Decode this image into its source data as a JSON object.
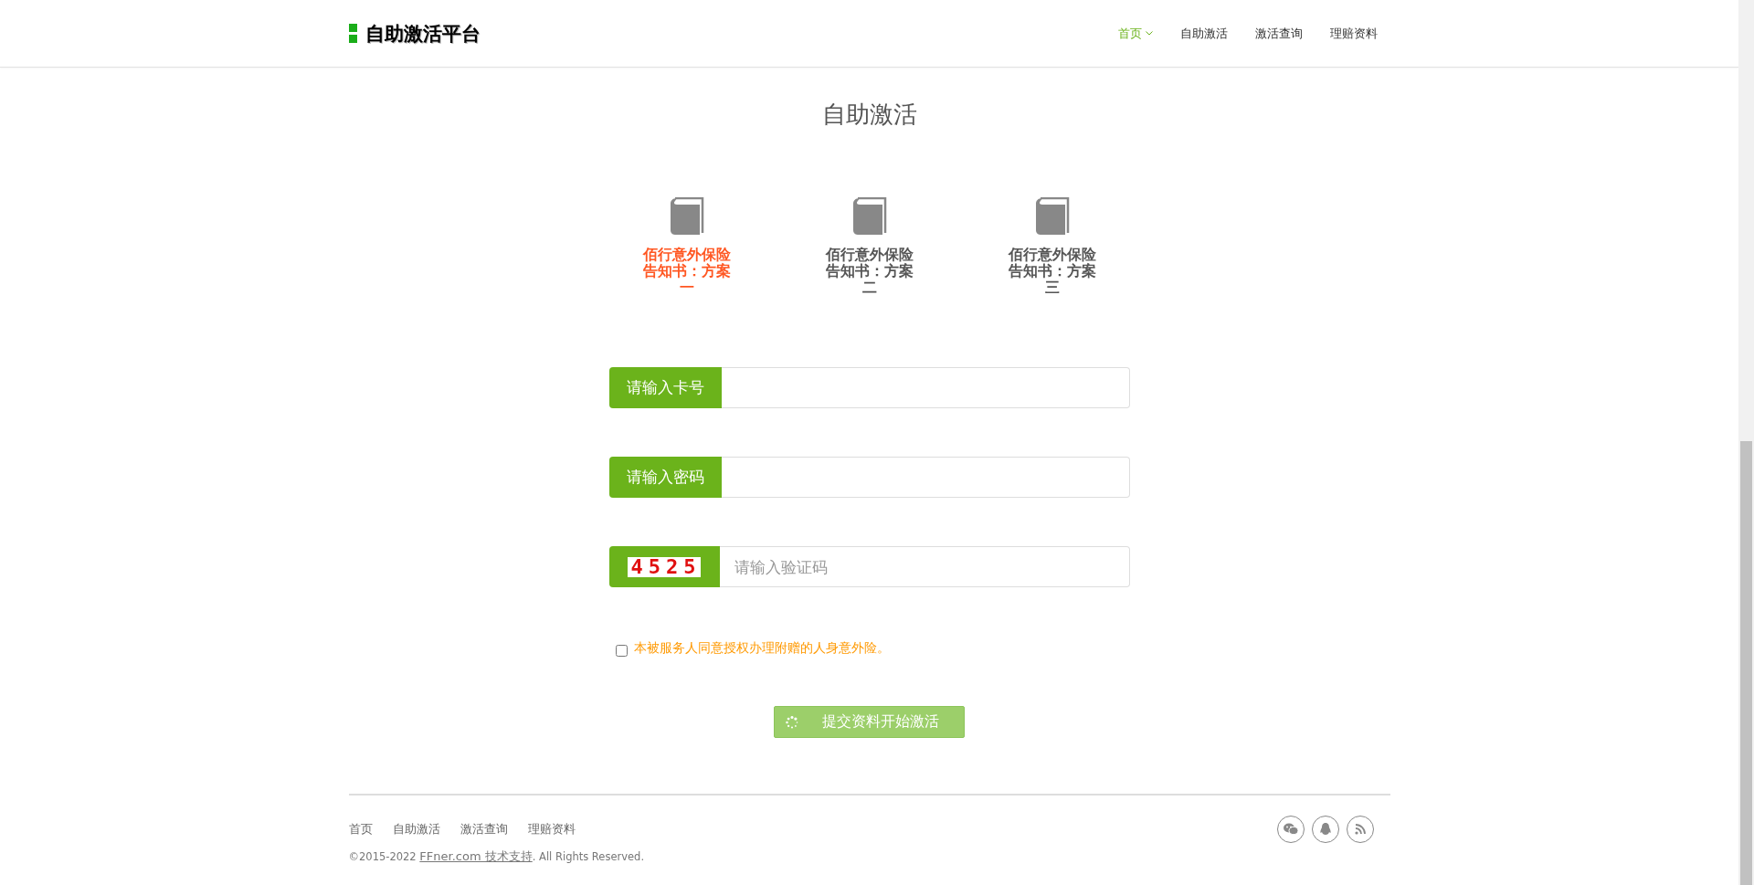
{
  "header": {
    "logo_text": "自助激活平台",
    "nav": [
      {
        "label": "首页",
        "selected": true,
        "dropdown": true
      },
      {
        "label": "自助激活",
        "selected": false,
        "dropdown": false
      },
      {
        "label": "激活查询",
        "selected": false,
        "dropdown": false
      },
      {
        "label": "理赔资料",
        "selected": false,
        "dropdown": false
      }
    ]
  },
  "page_title": "自助激活",
  "plans": [
    {
      "label": "佰行意外保险告知书：方案一",
      "selected": true
    },
    {
      "label": "佰行意外保险告知书：方案二",
      "selected": false
    },
    {
      "label": "佰行意外保险告知书：方案三",
      "selected": false
    }
  ],
  "fields": [
    {
      "kind": "label",
      "label": "请输入卡号"
    },
    {
      "kind": "label",
      "label": "请输入密码"
    },
    {
      "kind": "captcha",
      "captcha": "4525",
      "placeholder": "请输入验证码"
    }
  ],
  "agreement": {
    "checked": false,
    "text": "本被服务人同意授权办理附赠的人身意外险。"
  },
  "submit": {
    "label": "提交资料开始激活",
    "loading": true
  },
  "footer": {
    "links": [
      "首页",
      "自助激活",
      "激活查询",
      "理赔资料"
    ],
    "copyright_prefix": "©2015-2022 ",
    "copyright_link": "FFner.com 技术支持",
    "copyright_suffix": ". All Rights Reserved."
  }
}
